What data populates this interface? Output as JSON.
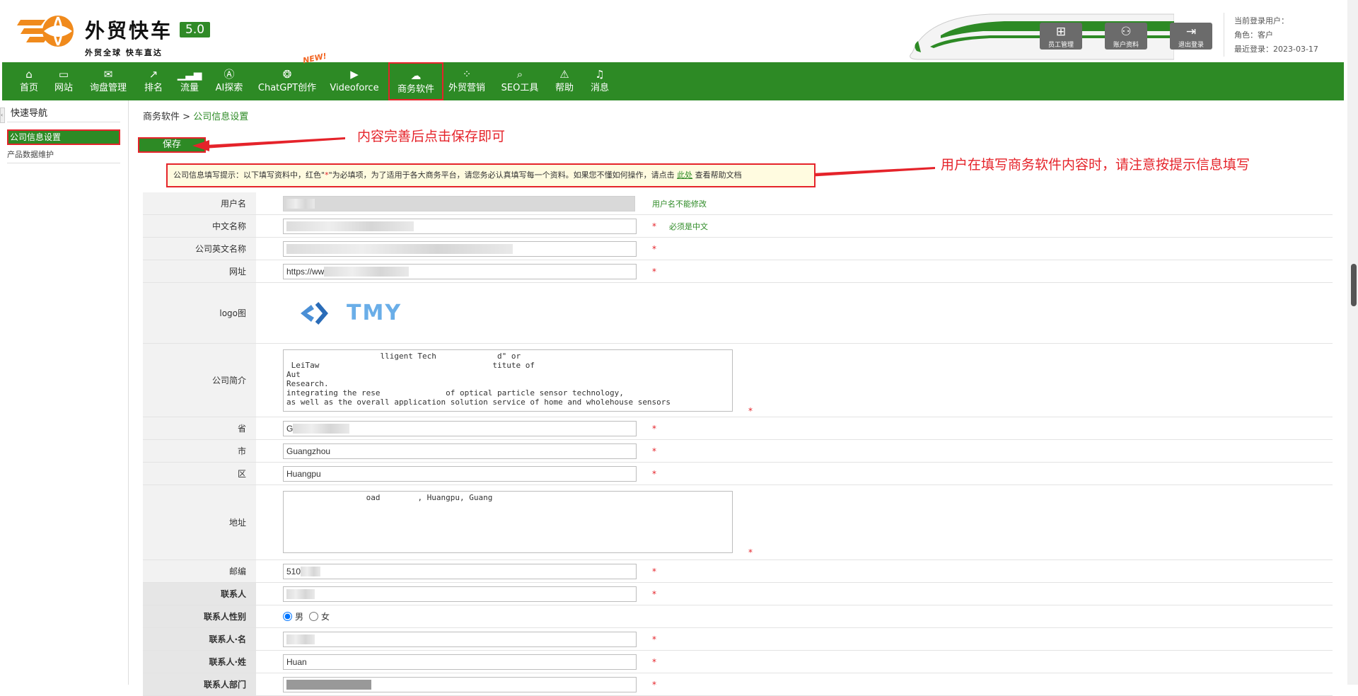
{
  "brand": {
    "name": "外贸快车",
    "version": "5.0",
    "slogan": "外贸全球 快车直达"
  },
  "header_buttons": [
    {
      "label": "员工管理",
      "icon": "staff-icon"
    },
    {
      "label": "账户资料",
      "icon": "account-icon"
    },
    {
      "label": "退出登录",
      "icon": "logout-icon"
    }
  ],
  "user_info": {
    "current_user_label": "当前登录用户：",
    "role_label": "角色：客户",
    "last_login_label": "最近登录：2023-03-17"
  },
  "nav": [
    {
      "label": "首页",
      "icon": "home-icon"
    },
    {
      "label": "网站",
      "icon": "website-icon"
    },
    {
      "label": "询盘管理",
      "icon": "mail-icon"
    },
    {
      "label": "排名",
      "icon": "ranking-icon"
    },
    {
      "label": "流量",
      "icon": "traffic-icon"
    },
    {
      "label": "AI探索",
      "icon": "ai-icon"
    },
    {
      "label": "ChatGPT创作",
      "icon": "chatgpt-icon"
    },
    {
      "label": "Videoforce",
      "icon": "video-icon"
    },
    {
      "label": "商务软件",
      "icon": "business-software-icon"
    },
    {
      "label": "外贸营销",
      "icon": "marketing-icon"
    },
    {
      "label": "SEO工具",
      "icon": "search-icon"
    },
    {
      "label": "帮助",
      "icon": "help-icon"
    },
    {
      "label": "消息",
      "icon": "bell-icon"
    }
  ],
  "new_badge": "NEW!",
  "sidebar": {
    "title": "快速导航",
    "items": [
      "公司信息设置",
      "产品数据维护"
    ]
  },
  "breadcrumb": {
    "parent": "商务软件",
    "sep": " > ",
    "current": "公司信息设置"
  },
  "save_button": "保存",
  "annotations": {
    "save_note": "内容完善后点击保存即可",
    "tip_note": "用户在填写商务软件内容时，请注意按提示信息填写"
  },
  "tip": {
    "prefix": "公司信息填写提示：以下填写资料中，红色\"",
    "star": "*",
    "middle": "\"为必填项，为了适用于各大商务平台，请您务必认真填写每一个资料。如果您不懂如何操作，请点击",
    "link": "此处",
    "suffix": "查看帮助文档"
  },
  "form": {
    "username_label": "用户名",
    "username_hint": "用户名不能修改",
    "cn_name_label": "中文名称",
    "cn_name_hint": "必须是中文",
    "en_name_label": "公司英文名称",
    "website_label": "网址",
    "website_value": "https://ww",
    "logo_label": "logo图",
    "logo_text": "TMY",
    "intro_label": "公司简介",
    "intro_value": "                    lligent Tech             d\" or\n LeiTaw                                     titute of\nAut\nResearch.\nintegrating the rese              of optical particle sensor technology,\nas well as the overall application solution service of home and wholehouse sensors",
    "province_label": "省",
    "province_value": "G",
    "city_label": "市",
    "city_value": "Guangzhou",
    "district_label": "区",
    "district_value": "Huangpu",
    "address_label": "地址",
    "address_value": "                 oad        , Huangpu, Guang",
    "zip_label": "邮编",
    "zip_value": "510",
    "contact_label": "联系人",
    "gender_label": "联系人性别",
    "gender_options": [
      "男",
      "女"
    ],
    "first_name_label": "联系人·名",
    "last_name_label": "联系人·姓",
    "last_name_value": "Huan",
    "dept_label": "联系人部门",
    "required_mark": "*"
  },
  "colors": {
    "brand_green": "#2d8a25",
    "highlight_red": "#e5232a"
  }
}
